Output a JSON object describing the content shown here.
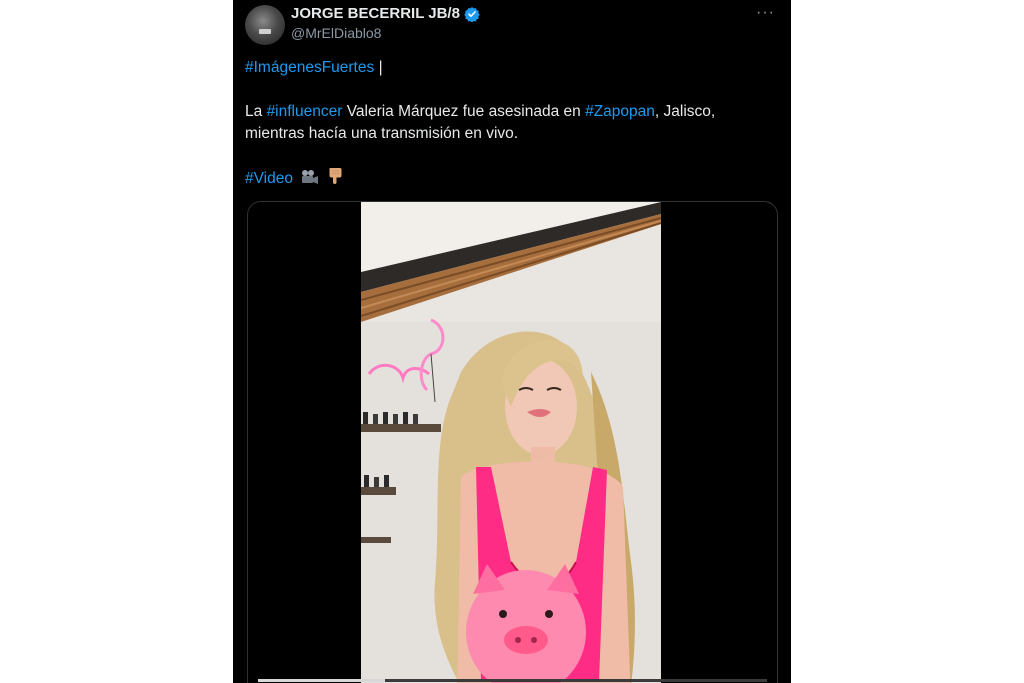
{
  "author": {
    "display_name": "JORGE BECERRIL JB/8",
    "handle": "@MrElDiablo8"
  },
  "tweet": {
    "hashtag_top": "#ImágenesFuertes",
    "cursor_mark": "|",
    "line2": {
      "prefix": "La ",
      "hashtag_influencer": "#influencer",
      "middle": " Valeria Márquez fue asesinada en ",
      "hashtag_zapopan": "#Zapopan",
      "suffix": ", Jalisco,"
    },
    "line3": "mientras hacía una transmisión en vivo.",
    "hashtag_video": "#Video",
    "emoji_icons": [
      "movie-camera-icon",
      "pointing-down-icon"
    ]
  },
  "more_menu": "···",
  "media": {
    "type": "video",
    "progress": 0.25
  },
  "colors": {
    "background": "#000000",
    "text": "#e7e9ea",
    "secondary": "#8b98a5",
    "link": "#1d9bf0",
    "verified": "#1d9bf0",
    "border": "#2f3336"
  }
}
